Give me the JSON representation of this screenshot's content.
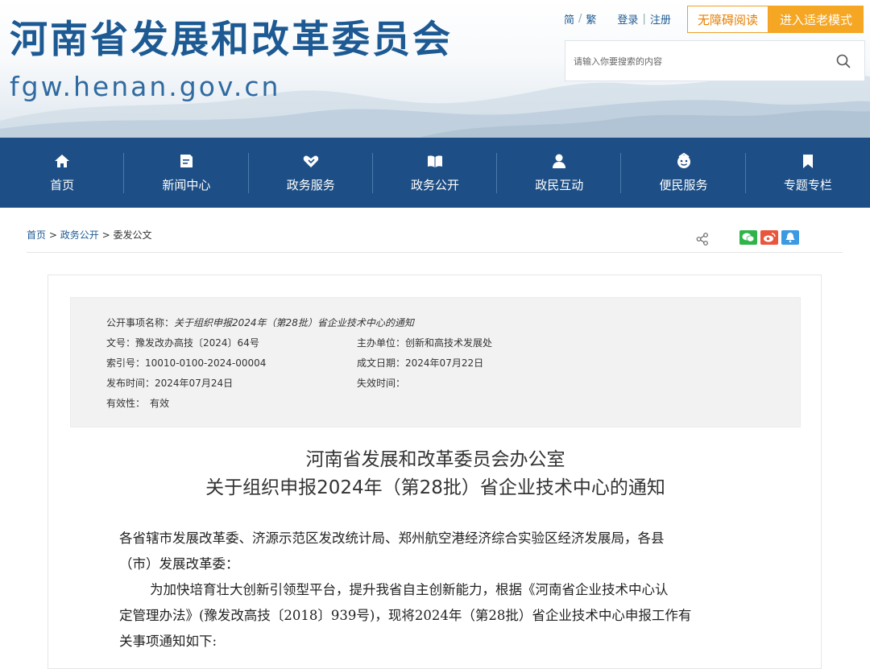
{
  "header": {
    "site_title": "河南省发展和改革委员会",
    "site_domain": "fgw.henan.gov.cn",
    "lang_simplified": "简",
    "lang_sep": "/",
    "lang_traditional": "繁",
    "login": "登录",
    "auth_sep": "|",
    "register": "注册",
    "accessible_reading": "无障碍阅读",
    "elder_mode": "进入适老模式",
    "search_placeholder": "请输入你要搜索的内容",
    "colors": {
      "brand": "#1d5a93",
      "accent": "#f5a623"
    }
  },
  "nav": {
    "items": [
      {
        "label": "首页",
        "icon": "home-icon"
      },
      {
        "label": "新闻中心",
        "icon": "news-icon"
      },
      {
        "label": "政务服务",
        "icon": "handshake-icon"
      },
      {
        "label": "政务公开",
        "icon": "book-icon"
      },
      {
        "label": "政民互动",
        "icon": "people-icon"
      },
      {
        "label": "便民服务",
        "icon": "service-icon"
      },
      {
        "label": "专题专栏",
        "icon": "bookmark-icon"
      }
    ]
  },
  "breadcrumb": {
    "home": "首页",
    "sep1": ">",
    "level2": "政务公开",
    "sep2": ">",
    "level3": "委发公文"
  },
  "meta": {
    "item_name_label": "公开事项名称：",
    "item_name": "关于组织申报2024年（第28批）省企业技术中心的通知",
    "doc_no_label": "文号：",
    "doc_no": "豫发改办高技〔2024〕64号",
    "host_unit_label": "主办单位：",
    "host_unit": "创新和高技术发展处",
    "index_no_label": "索引号：",
    "index_no": "10010-0100-2024-00004",
    "date_written_label": "成文日期：",
    "date_written": "2024年07月22日",
    "publish_time_label": "发布时间：",
    "publish_time": "2024年07月24日",
    "expire_time_label": "失效时间：",
    "expire_time": "",
    "validity_label": "有效性：",
    "validity": "有效"
  },
  "doc": {
    "title_line1": "河南省发展和改革委员会办公室",
    "title_line2": "关于组织申报2024年（第28批）省企业技术中心的通知",
    "para1_line1": "各省辖市发展改革委、济源示范区发改统计局、郑州航空港经济综合实验区经济发展局，各县",
    "para1_line2": "（市）发展改革委：",
    "para2_line1": "为加快培育壮大创新引领型平台，提升我省自主创新能力，根据《河南省企业技术中心认",
    "para2_line2": "定管理办法》(豫发改高技〔2018〕939号)，现将2024年（第28批）省企业技术中心申报工作有",
    "para2_line3": "关事项通知如下:"
  }
}
